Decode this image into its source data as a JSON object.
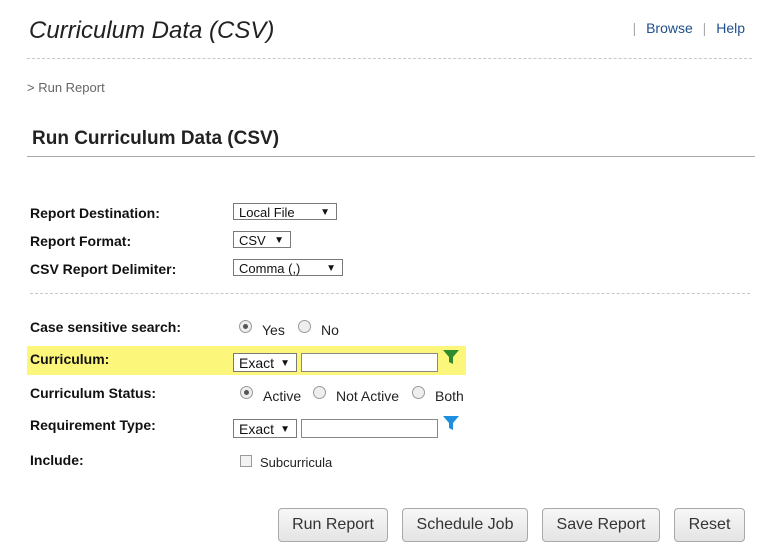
{
  "header": {
    "title": "Curriculum Data (CSV)",
    "links": [
      "Browse",
      "Help"
    ]
  },
  "breadcrumb": "> Run Report",
  "section_title": "Run Curriculum Data (CSV)",
  "fields": {
    "report_destination": {
      "label": "Report Destination:",
      "value": "Local File"
    },
    "report_format": {
      "label": "Report Format:",
      "value": "CSV"
    },
    "csv_delimiter": {
      "label": "CSV Report Delimiter:",
      "value": "Comma (,)"
    },
    "case_sensitive": {
      "label": "Case sensitive search:",
      "options": [
        "Yes",
        "No"
      ],
      "selected": "Yes"
    },
    "curriculum": {
      "label": "Curriculum:",
      "match": "Exact",
      "value": ""
    },
    "curriculum_status": {
      "label": "Curriculum Status:",
      "options": [
        "Active",
        "Not Active",
        "Both"
      ],
      "selected": "Active"
    },
    "requirement_type": {
      "label": "Requirement Type:",
      "match": "Exact",
      "value": ""
    },
    "include": {
      "label": "Include:",
      "option": "Subcurricula",
      "checked": false
    }
  },
  "buttons": {
    "run": "Run Report",
    "schedule": "Schedule Job",
    "save": "Save Report",
    "reset": "Reset"
  },
  "colors": {
    "highlight": "#fcf67b",
    "filter_active": "#2e8b2e",
    "filter_inactive": "#1e8fe0"
  },
  "icons": {
    "curriculum_filter": "funnel-icon",
    "requirement_filter": "funnel-icon"
  }
}
